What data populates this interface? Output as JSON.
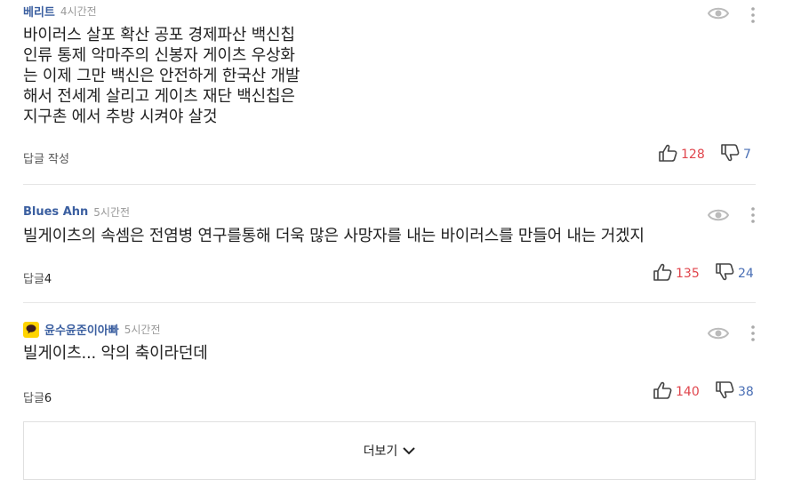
{
  "comments": [
    {
      "author": "베리트",
      "time": "4시간전",
      "text": "바이러스 살포 확산 공포  경제파산 백신칩\n인류 통제  악마주의 신봉자 게이츠 우상화\n는 이제 그만  백신은  안전하게  한국산 개발\n해서  전세계 살리고  게이츠 재단  백신칩은\n지구촌 에서 추방 시켜야  살것",
      "reply_label": "답글 작성",
      "reply_count": "",
      "likes": "128",
      "dislikes": "7"
    },
    {
      "author": "Blues Ahn",
      "time": "5시간전",
      "text": "빌게이츠의 속셈은 전염병 연구를통해 더욱 많은 사망자를 내는 바이러스를 만들어 내는 거겠지",
      "reply_label": "답글",
      "reply_count": "4",
      "likes": "135",
      "dislikes": "24"
    },
    {
      "author": "윤수윤준이아빠",
      "time": "5시간전",
      "text": "빌게이츠... 악의 축이라던데",
      "reply_label": "답글",
      "reply_count": "6",
      "likes": "140",
      "dislikes": "38"
    }
  ],
  "more_label": "더보기",
  "icons": {
    "view": "eye-icon",
    "menu": "kebab-icon",
    "like": "thumbs-up-icon",
    "dislike": "thumbs-down-icon",
    "profile": "kakao-talk-icon",
    "more": "chevron-down-icon"
  },
  "colors": {
    "author": "#3b5fa0",
    "likes": "#e0454c",
    "dislikes": "#4a6fb5",
    "profile_badge": "#ffd400"
  }
}
